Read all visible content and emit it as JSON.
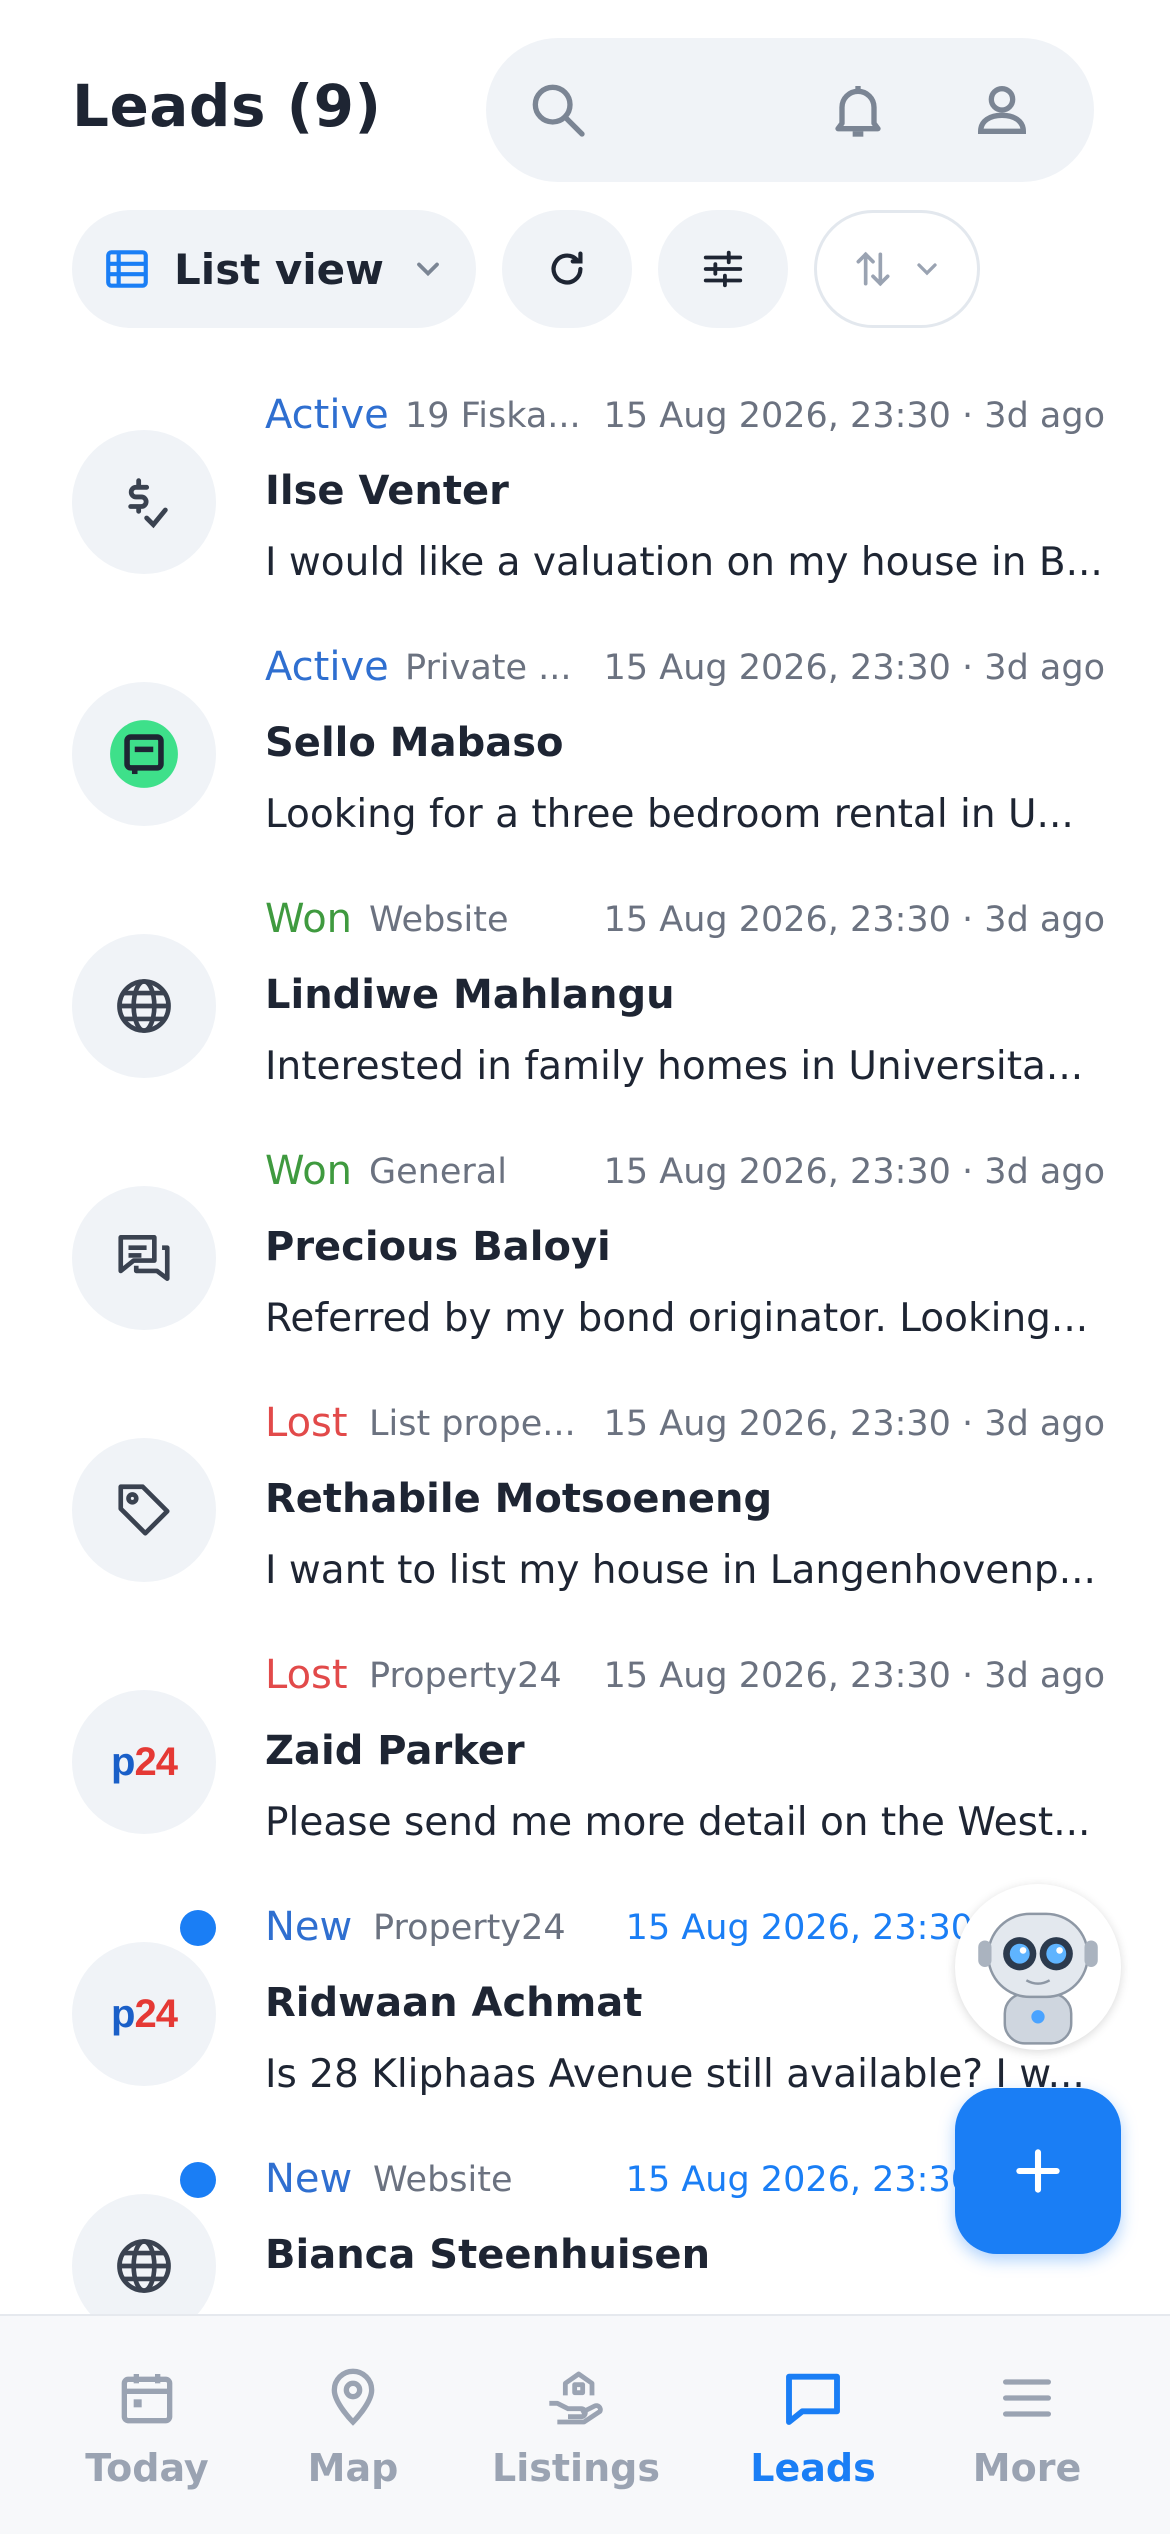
{
  "header": {
    "title": "Leads (9)",
    "icons": [
      "search-icon",
      "bell-icon",
      "user-icon"
    ]
  },
  "toolbar": {
    "view_label": "List view",
    "icons": [
      "list-icon",
      "chevron-down-icon",
      "refresh-icon",
      "filter-sliders-icon",
      "sort-icon"
    ]
  },
  "leads": [
    {
      "status": "Active",
      "status_color": "#2f6fd0",
      "source": "19 Fiska...",
      "date": "15 Aug 2026, 23:30 · 3d ago",
      "name": "Ilse Venter",
      "message": "I would like a valuation on my house in B...",
      "icon": "valuation-icon",
      "unread": false
    },
    {
      "status": "Active",
      "status_color": "#2f6fd0",
      "source": "Private ...",
      "date": "15 Aug 2026, 23:30 · 3d ago",
      "name": "Sello Mabaso",
      "message": "Looking for a three bedroom rental in U...",
      "icon": "private-property-icon",
      "unread": false
    },
    {
      "status": "Won",
      "status_color": "#3f9a3f",
      "source": "Website",
      "date": "15 Aug 2026, 23:30 · 3d ago",
      "name": "Lindiwe Mahlangu",
      "message": "Interested in family homes in Universita...",
      "icon": "globe-icon",
      "unread": false
    },
    {
      "status": "Won",
      "status_color": "#3f9a3f",
      "source": "General",
      "date": "15 Aug 2026, 23:30 · 3d ago",
      "name": "Precious Baloyi",
      "message": "Referred by my bond originator. Looking...",
      "icon": "chat-bubbles-icon",
      "unread": false
    },
    {
      "status": "Lost",
      "status_color": "#e24a4a",
      "source": "List prope...",
      "date": "15 Aug 2026, 23:30 · 3d ago",
      "name": "Rethabile Motsoeneng",
      "message": "I want to list my house in Langenhovenp...",
      "icon": "tag-icon",
      "unread": false
    },
    {
      "status": "Lost",
      "status_color": "#e24a4a",
      "source": "Property24",
      "date": "15 Aug 2026, 23:30 · 3d ago",
      "name": "Zaid Parker",
      "message": "Please send me more detail on the West...",
      "icon": "p24-logo",
      "unread": false
    },
    {
      "status": "New",
      "status_color": "#2f6fd0",
      "source": "Property24",
      "date": "15 Aug 2026, 23:30",
      "name": "Ridwaan Achmat",
      "message": "Is 28 Kliphaas Avenue still available? I w...",
      "icon": "p24-logo",
      "unread": true
    },
    {
      "status": "New",
      "status_color": "#2f6fd0",
      "source": "Website",
      "date": "15 Aug 2026, 23:30",
      "name": "Bianca Steenhuisen",
      "message": "",
      "icon": "globe-icon",
      "unread": true
    }
  ],
  "p24_logo": {
    "p": "p",
    "num": "24"
  },
  "fab": {
    "icon": "plus-icon"
  },
  "assistant": {
    "icon": "robot-assistant-icon"
  },
  "tabbar": {
    "tabs": [
      {
        "label": "Today",
        "icon": "calendar-icon",
        "active": false
      },
      {
        "label": "Map",
        "icon": "map-pin-icon",
        "active": false
      },
      {
        "label": "Listings",
        "icon": "house-hand-icon",
        "active": false
      },
      {
        "label": "Leads",
        "icon": "message-icon",
        "active": true
      },
      {
        "label": "More",
        "icon": "menu-icon",
        "active": false
      }
    ]
  },
  "colors": {
    "accent": "#1a7ef5",
    "active": "#2f6fd0",
    "won": "#3f9a3f",
    "lost": "#e24a4a"
  }
}
